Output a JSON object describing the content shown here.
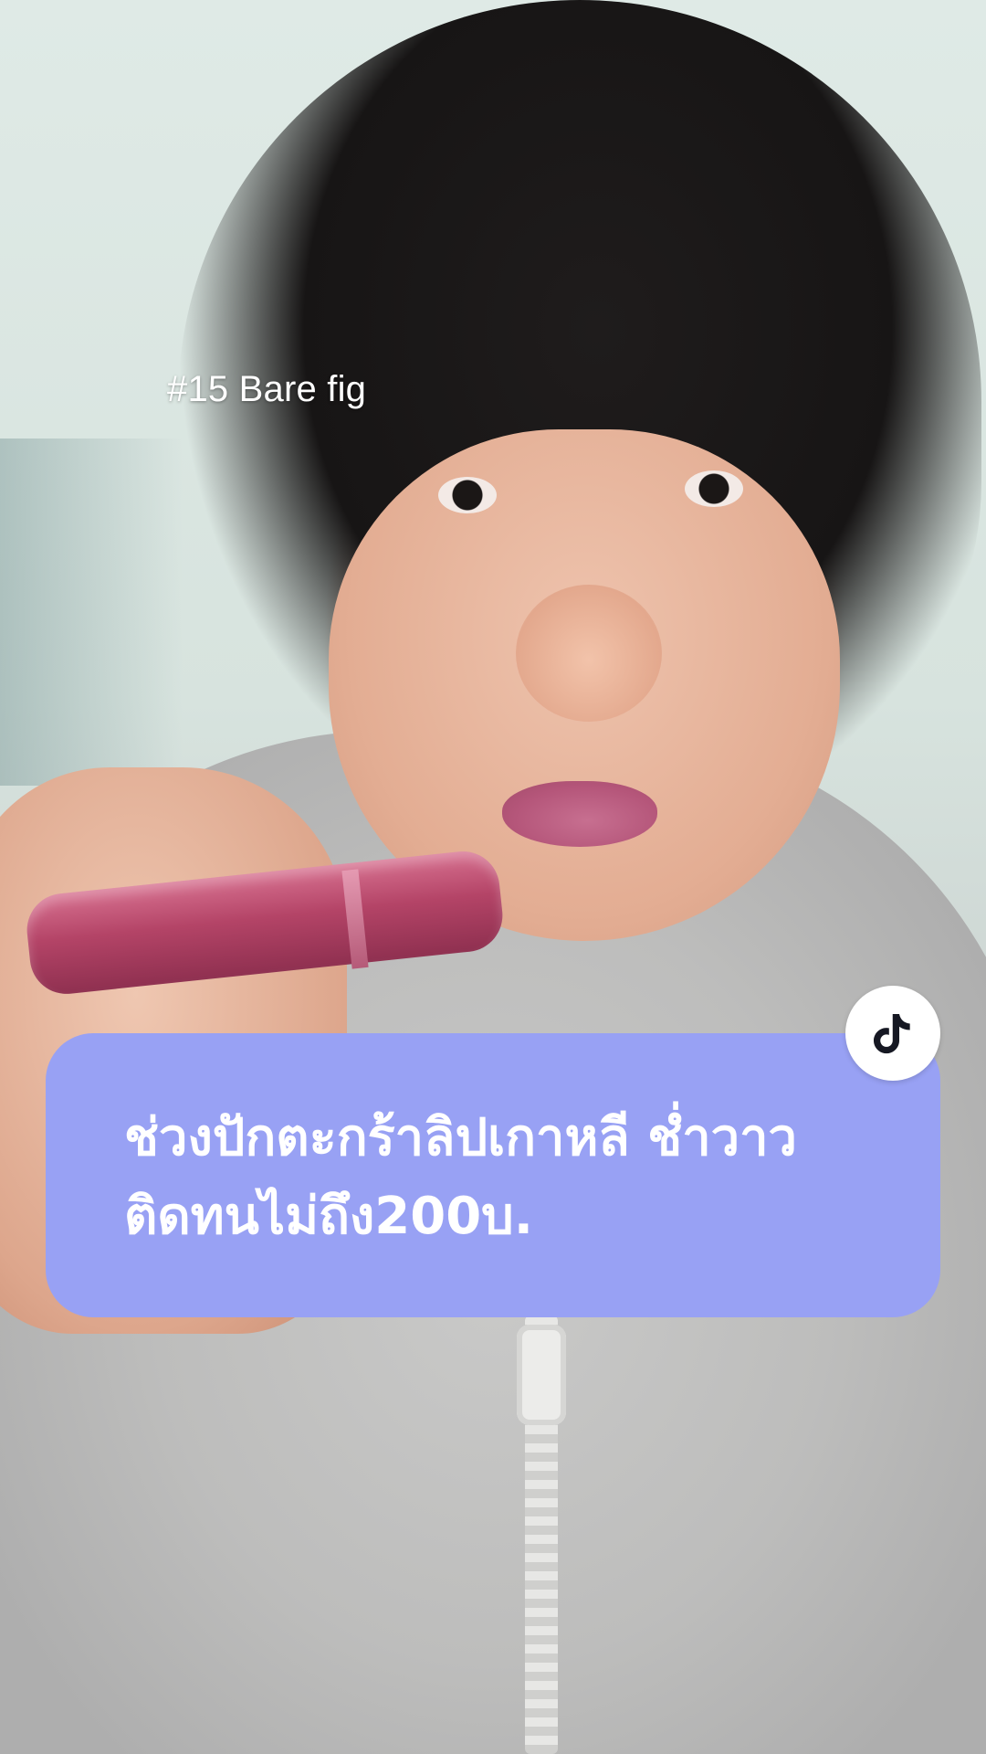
{
  "overlay": {
    "tag_text": "#15 Bare fig",
    "caption_lines": [
      "ช่วงปักตะกร้าลิปเกาหลี ช่ำวาว",
      "ติดทนไม่ถึง200บ."
    ],
    "caption_bg_color": "#98a1f4",
    "caption_text_color": "#ffffff"
  },
  "badge": {
    "icon": "tiktok-logo-icon"
  }
}
